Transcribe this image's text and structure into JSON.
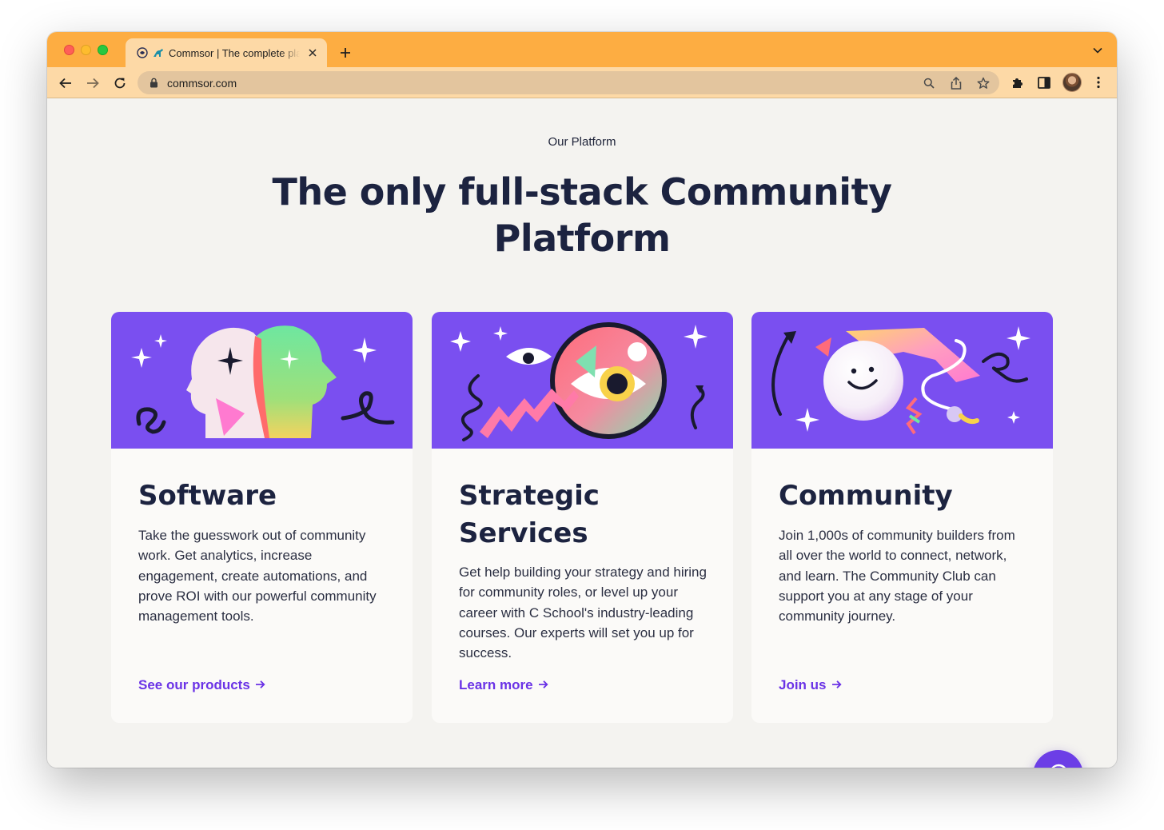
{
  "browser": {
    "tab_title": "Commsor | The complete platform",
    "url": "commsor.com"
  },
  "page": {
    "eyebrow": "Our Platform",
    "headline_line1": "The only full-stack Community",
    "headline_line2": "Platform"
  },
  "cards": [
    {
      "title": "Software",
      "body": "Take the guesswork out of community work. Get analytics, increase engagement, create automations, and prove ROI with our powerful community management tools.",
      "cta": "See our products"
    },
    {
      "title": "Strategic Services",
      "body": "Get help building your strategy and hiring for community roles, or level up your career with C School's industry-leading courses. Our experts will set you up for success.",
      "cta": "Learn more"
    },
    {
      "title": "Community",
      "body": "Join 1,000s of community builders from all over the world to connect, network, and learn. The Community Club can support you at any stage of your community journey.",
      "cta": "Join us"
    }
  ],
  "icons": {
    "arrow": "arrow-right-icon",
    "chat": "chat-bubble-icon"
  },
  "colors": {
    "accent": "#6a32e6",
    "illustration_bg": "#7a4ff0",
    "heading": "#1c2340",
    "tabstrip": "#fdad42"
  }
}
